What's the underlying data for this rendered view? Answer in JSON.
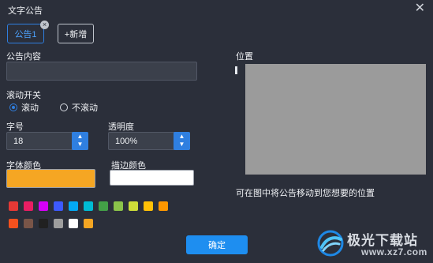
{
  "window": {
    "title": "文字公告"
  },
  "tabs": {
    "notice_tab_label": "公告1",
    "add_label": "+新增"
  },
  "form": {
    "content_label": "公告内容",
    "content_value": "",
    "scroll_label": "滚动开关",
    "scroll_on_label": "滚动",
    "scroll_off_label": "不滚动",
    "font_size_label": "字号",
    "font_size_value": "18",
    "opacity_label": "透明度",
    "opacity_value": "100%",
    "font_color_label": "字体颜色",
    "stroke_color_label": "描边颜色",
    "font_color": "#f5a623",
    "stroke_color": "#ffffff"
  },
  "palette": {
    "row1": [
      "#e53935",
      "#e91e63",
      "#d500f9",
      "#3d5afe",
      "#03a9f4",
      "#00bcd4",
      "#43a047",
      "#8bc34a",
      "#cddc39",
      "#ffc107",
      "#ff9800"
    ],
    "row2": [
      "#f4511e",
      "#795548",
      "#212121",
      "#9e9e9e",
      "#ffffff",
      "#f5a623"
    ]
  },
  "position": {
    "label": "位置",
    "hint": "可在图中将公告移动到您想要的位置"
  },
  "actions": {
    "confirm_label": "确定"
  },
  "watermark": {
    "text": "极光下载站",
    "url": "www.xz7.com"
  },
  "icons": {
    "close": "close-icon",
    "tab_close": "tab-close-icon",
    "spin": "spinner-arrows-icon",
    "logo": "aurora-logo-icon"
  }
}
